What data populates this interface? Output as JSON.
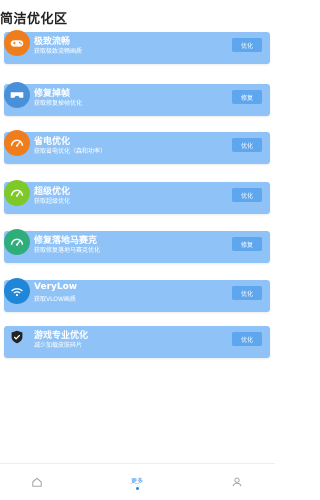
{
  "section": {
    "title": "简洁优化区"
  },
  "cards": [
    {
      "title": "极致流畅",
      "subtitle": "获取极致流畅画质",
      "button": "优化",
      "icon": "gamepad-icon",
      "icon_color": "#f07d1c"
    },
    {
      "title": "修复掉帧",
      "subtitle": "获取修复掉帧优化",
      "button": "修复",
      "icon": "vr-headset-icon",
      "icon_color": "#4a90d9"
    },
    {
      "title": "省电优化",
      "subtitle": "获取省电优化（森和功率）",
      "button": "优化",
      "icon": "speed-gauge-icon",
      "icon_color": "#f07d1c"
    },
    {
      "title": "超级优化",
      "subtitle": "获取超级优化",
      "button": "优化",
      "icon": "speed-gauge-icon",
      "icon_color": "#7ec82a"
    },
    {
      "title": "修复落地马赛克",
      "subtitle": "获取修复落地马赛克优化",
      "button": "修复",
      "icon": "speed-gauge-icon",
      "icon_color": "#2fae7c"
    },
    {
      "title": "VeryLow",
      "subtitle": "获取VLOW画质",
      "button": "优化",
      "icon": "wifi-icon",
      "icon_color": "#1f86d8"
    },
    {
      "title": "游戏专业优化",
      "subtitle": "减少加载皮肤碎片",
      "button": "优化",
      "icon": "shield-icon",
      "icon_color": "#8fc3f7"
    }
  ],
  "nav": {
    "items": [
      {
        "icon": "home-icon",
        "label": ""
      },
      {
        "icon": "more-icon",
        "label": "更多"
      },
      {
        "icon": "profile-icon",
        "label": ""
      }
    ],
    "active_color": "#2f8be6"
  }
}
